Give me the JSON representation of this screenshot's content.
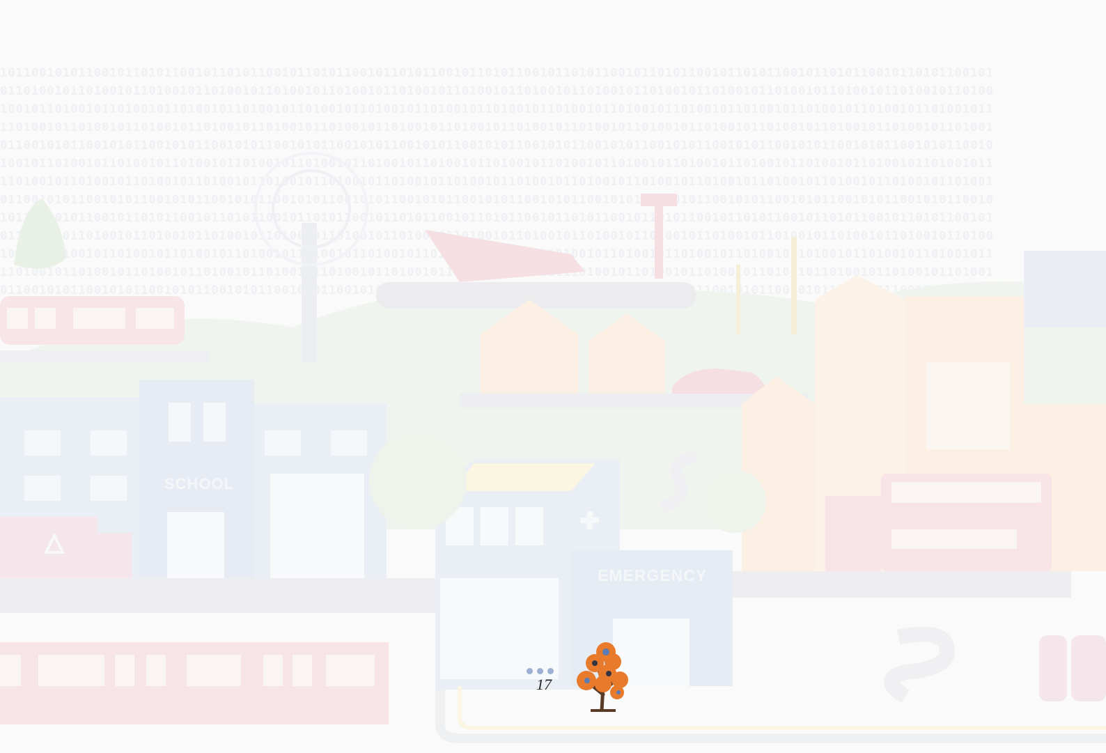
{
  "footer": {
    "page_number": "17"
  },
  "illustration": {
    "school_sign": "SCHOOL",
    "emergency_sign": "EMERGENCY"
  },
  "colors": {
    "background": "#fafafa",
    "page_dots": "#9cb0d3",
    "logo_orange": "#e87a2c"
  },
  "icons": [
    "recycle-icon",
    "medical-cross-icon",
    "tree-logo-icon"
  ]
}
